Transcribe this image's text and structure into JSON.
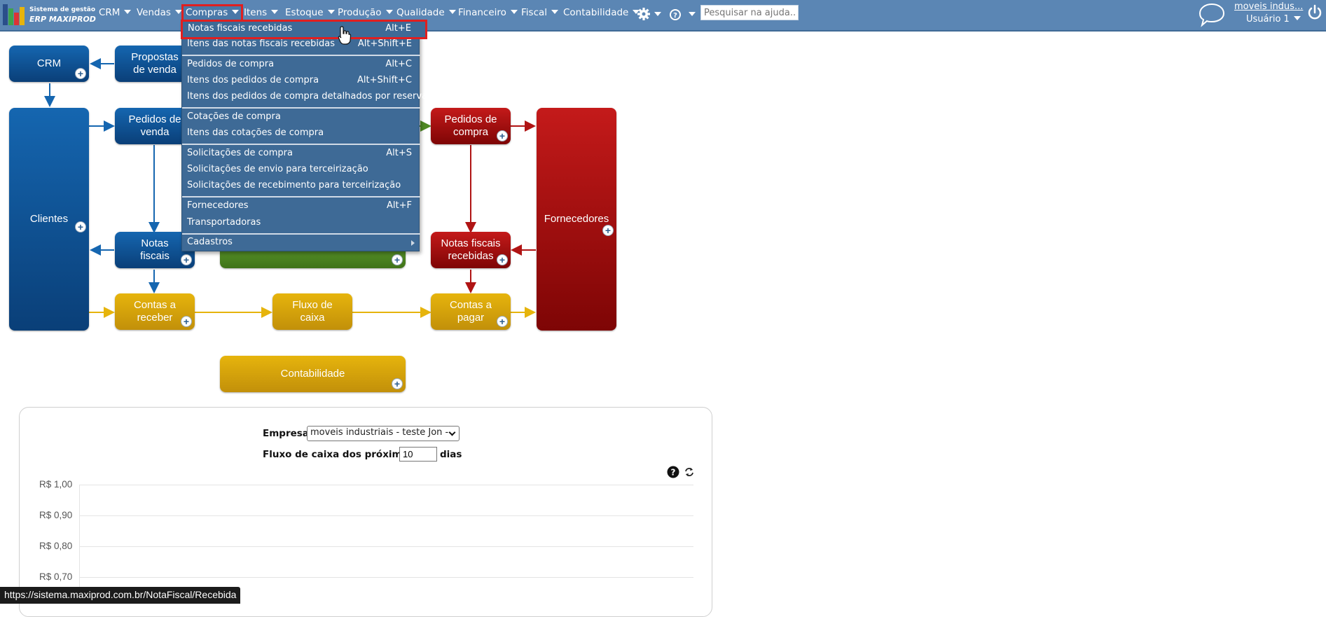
{
  "logo": {
    "line1": "Sistema de gestão",
    "line2": "ERP MAXIPROD"
  },
  "nav": [
    {
      "label": "CRM"
    },
    {
      "label": "Vendas"
    },
    {
      "label": "Compras"
    },
    {
      "label": "Itens"
    },
    {
      "label": "Estoque"
    },
    {
      "label": "Produção"
    },
    {
      "label": "Qualidade"
    },
    {
      "label": "Financeiro"
    },
    {
      "label": "Fiscal"
    },
    {
      "label": "Contabilidade"
    }
  ],
  "search": {
    "placeholder": "Pesquisar na ajuda..."
  },
  "user": {
    "company": "moveis indus...",
    "name": "Usuário 1"
  },
  "menu": {
    "items": [
      {
        "label": "Notas fiscais recebidas",
        "shortcut": "Alt+E"
      },
      {
        "label": "Itens das notas fiscais recebidas",
        "shortcut": "Alt+Shift+E"
      },
      {
        "label": "Pedidos de compra",
        "shortcut": "Alt+C"
      },
      {
        "label": "Itens dos pedidos de compra",
        "shortcut": "Alt+Shift+C"
      },
      {
        "label": "Itens dos pedidos de compra detalhados por reserva",
        "shortcut": ""
      },
      {
        "label": "Cotações de compra",
        "shortcut": ""
      },
      {
        "label": "Itens das cotações de compra",
        "shortcut": ""
      },
      {
        "label": "Solicitações de compra",
        "shortcut": "Alt+S"
      },
      {
        "label": "Solicitações de envio para terceirização",
        "shortcut": ""
      },
      {
        "label": "Solicitações de recebimento para terceirização",
        "shortcut": ""
      },
      {
        "label": "Fornecedores",
        "shortcut": "Alt+F"
      },
      {
        "label": "Transportadoras",
        "shortcut": ""
      },
      {
        "label": "Cadastros",
        "shortcut": ""
      }
    ]
  },
  "diagram": {
    "crm": "CRM",
    "propostas": "Propostas de venda",
    "clientes": "Clientes",
    "pedidos_venda": "Pedidos de venda",
    "notas_fiscais": "Notas fiscais",
    "pedidos_compra": "Pedidos de compra",
    "notas_recebidas": "Notas fiscais recebidas",
    "fornecedores": "Fornecedores",
    "contas_receber": "Contas a receber",
    "fluxo_caixa": "Fluxo de caixa",
    "contas_pagar": "Contas a pagar",
    "contabilidade": "Contabilidade"
  },
  "panel": {
    "empresa_label": "Empresa",
    "empresa_value": "moveis industriais - teste Jon -",
    "fluxo_label": "Fluxo de caixa dos próximos",
    "dias_value": "10",
    "dias_suffix": "dias",
    "y_ticks": [
      "R$ 1,00",
      "R$ 0,90",
      "R$ 0,80",
      "R$ 0,70"
    ]
  },
  "status_url": "https://sistema.maxiprod.com.br/NotaFiscal/Recebida",
  "colors": {
    "topbar": "#5b86b4",
    "menu_bg": "#3e6a96",
    "highlight": "#e01f1f",
    "blue_box": "#0a4f94",
    "red_box": "#a80d0d",
    "gold_box": "#dba70c",
    "green_box": "#4f8a24"
  },
  "icons": [
    "gear-icon",
    "help-icon",
    "chat-icon",
    "power-icon",
    "plus-icon",
    "refresh-icon",
    "question-icon",
    "chevron-down-icon",
    "hand-cursor-icon"
  ]
}
